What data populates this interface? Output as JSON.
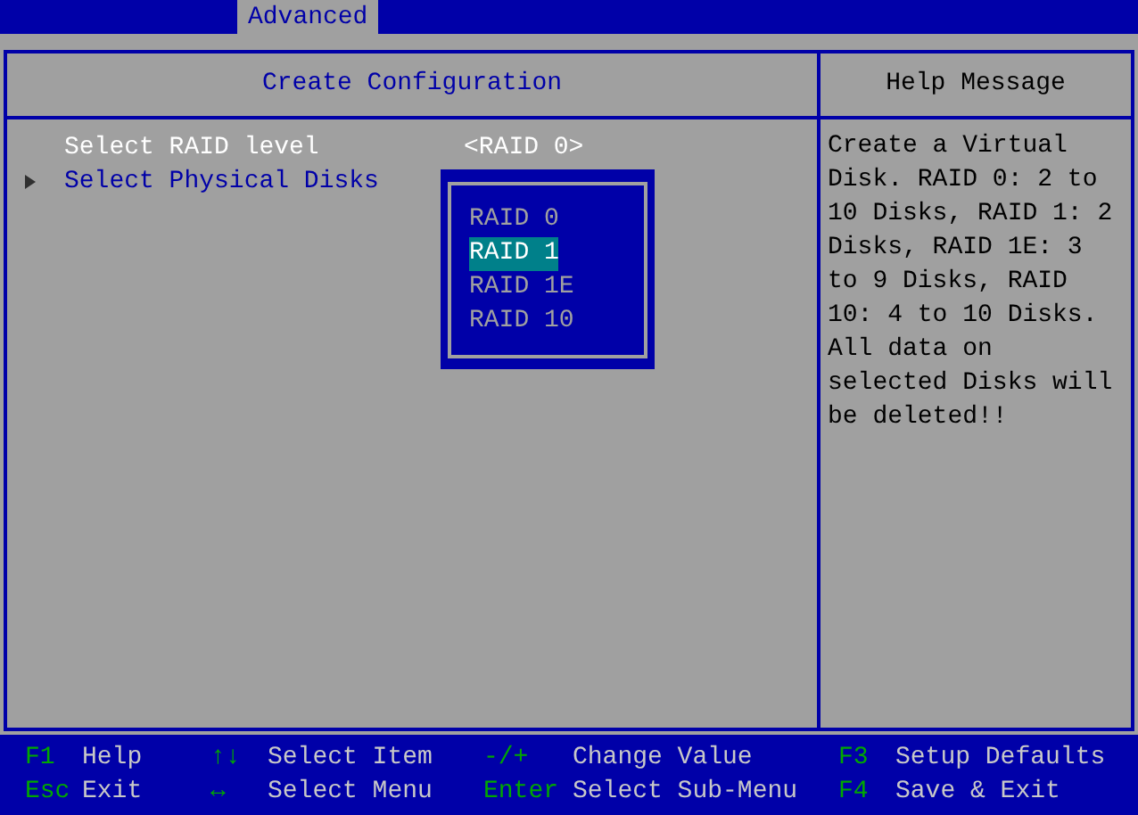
{
  "top_tabs": [
    {
      "label": "Advanced",
      "selected": true
    }
  ],
  "panel": {
    "title": "Create Configuration",
    "items": [
      {
        "kind": "option",
        "label": "Select RAID level",
        "value": "<RAID 0>",
        "selected": true
      },
      {
        "kind": "submenu",
        "label": "Select Physical Disks",
        "selected": false
      }
    ]
  },
  "popup": {
    "options": [
      {
        "label": "RAID 0",
        "selected": false
      },
      {
        "label": "RAID 1",
        "selected": true
      },
      {
        "label": "RAID 1E",
        "selected": false
      },
      {
        "label": "RAID 10",
        "selected": false
      }
    ]
  },
  "help": {
    "title": "Help Message",
    "text": "Create a Virtual Disk. RAID 0: 2 to 10 Disks, RAID 1: 2 Disks, RAID 1E: 3 to 9 Disks, RAID 10: 4 to 10 Disks. All data on selected Disks will be deleted!!"
  },
  "footer": [
    {
      "key": "F1",
      "action": "Help"
    },
    {
      "key": "↑↓",
      "action": "Select Item"
    },
    {
      "key": "-/+",
      "action": "Change Value"
    },
    {
      "key": "F3",
      "action": "Setup Defaults"
    },
    {
      "key": "Esc",
      "action": "Exit"
    },
    {
      "key": "↔",
      "action": "Select Menu"
    },
    {
      "key": "Enter",
      "action": "Select Sub-Menu"
    },
    {
      "key": "F4",
      "action": "Save & Exit"
    }
  ]
}
